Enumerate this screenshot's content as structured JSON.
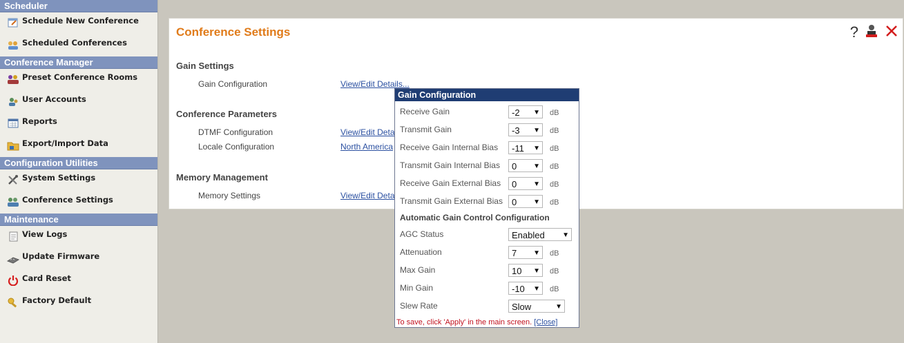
{
  "sidebar": {
    "sections": [
      {
        "title": "Scheduler",
        "items": [
          {
            "label": "Schedule New Conference",
            "icon": "calendar-edit-icon"
          },
          {
            "label": "Scheduled Conferences",
            "icon": "people-group-icon"
          }
        ]
      },
      {
        "title": "Conference Manager",
        "items": [
          {
            "label": "Preset Conference Rooms",
            "icon": "users-room-icon"
          },
          {
            "label": "User Accounts",
            "icon": "user-accounts-icon"
          },
          {
            "label": "Reports",
            "icon": "calendar-report-icon"
          },
          {
            "label": "Export/Import Data",
            "icon": "folder-export-icon"
          }
        ]
      },
      {
        "title": "Configuration Utilities",
        "items": [
          {
            "label": "System Settings",
            "icon": "tools-icon"
          },
          {
            "label": "Conference Settings",
            "icon": "conference-settings-icon"
          }
        ]
      },
      {
        "title": "Maintenance",
        "items": [
          {
            "label": "View Logs",
            "icon": "log-icon"
          },
          {
            "label": "Update Firmware",
            "icon": "firmware-icon"
          },
          {
            "label": "Card Reset",
            "icon": "power-icon"
          },
          {
            "label": "Factory Default",
            "icon": "factory-default-icon"
          }
        ]
      }
    ]
  },
  "main": {
    "title": "Conference Settings",
    "help": "?",
    "groups": {
      "gain": {
        "title": "Gain Settings",
        "rows": [
          {
            "label": "Gain Configuration",
            "link": "View/Edit Details..."
          }
        ]
      },
      "conference": {
        "title": "Conference Parameters",
        "rows": [
          {
            "label": "DTMF Configuration",
            "link": "View/Edit Deta"
          },
          {
            "label": "Locale Configuration",
            "link": "North America"
          }
        ]
      },
      "memory": {
        "title": "Memory Management",
        "rows": [
          {
            "label": "Memory Settings",
            "link": "View/Edit Deta"
          }
        ]
      }
    }
  },
  "popup": {
    "title": "Gain Configuration",
    "gain_rows": [
      {
        "label": "Receive Gain",
        "value": "-2",
        "unit": "dB"
      },
      {
        "label": "Transmit Gain",
        "value": "-3",
        "unit": "dB"
      },
      {
        "label": "Receive Gain Internal Bias",
        "value": "-11",
        "unit": "dB"
      },
      {
        "label": "Transmit Gain Internal Bias",
        "value": "0",
        "unit": "dB"
      },
      {
        "label": "Receive Gain External Bias",
        "value": "0",
        "unit": "dB"
      },
      {
        "label": "Transmit Gain External Bias",
        "value": "0",
        "unit": "dB"
      }
    ],
    "agc_title": "Automatic Gain Control Configuration",
    "agc_rows": [
      {
        "label": "AGC Status",
        "value": "Enabled",
        "unit": ""
      },
      {
        "label": "Attenuation",
        "value": "7",
        "unit": "dB"
      },
      {
        "label": "Max Gain",
        "value": "10",
        "unit": "dB"
      },
      {
        "label": "Min Gain",
        "value": "-10",
        "unit": "dB"
      },
      {
        "label": "Slew Rate",
        "value": "Slow",
        "unit": ""
      }
    ],
    "save_note": "To save, click 'Apply' in the main screen.",
    "close_label": "[Close]"
  },
  "colors": {
    "section_header": "#7f93bd",
    "title_orange": "#e07b1a",
    "popup_header": "#1f3d73",
    "link_blue": "#2a4fa0",
    "note_red": "#c1121f"
  }
}
